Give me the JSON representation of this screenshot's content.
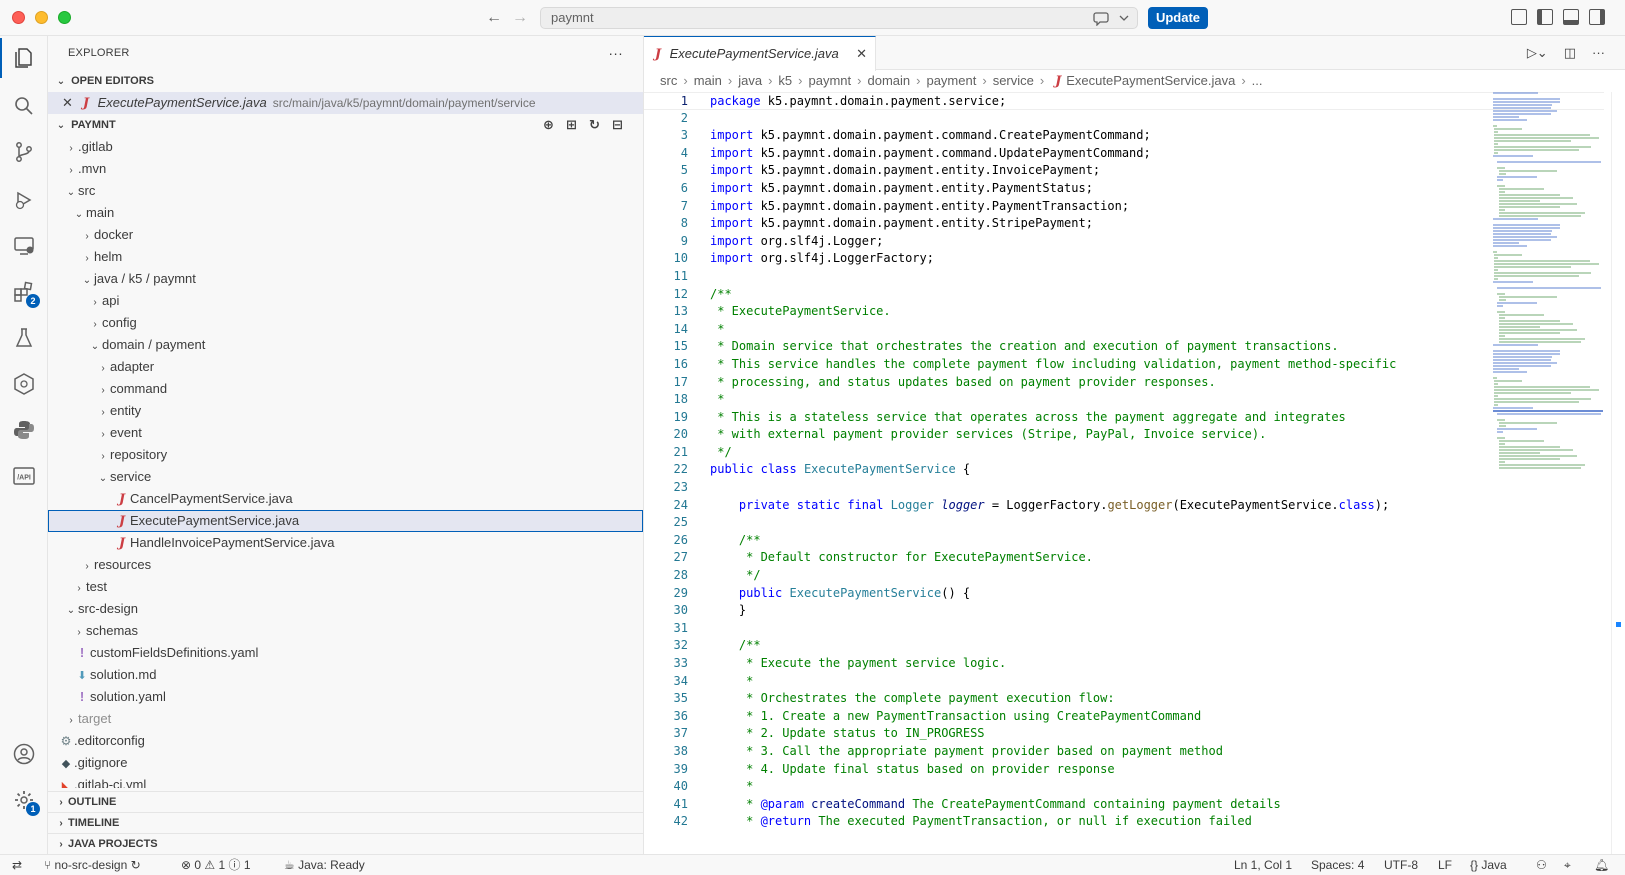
{
  "titlebar": {
    "search_value": "paymnt",
    "update_label": "Update"
  },
  "activity": {
    "extensions_badge": "2",
    "settings_badge": "1"
  },
  "sidebar": {
    "title": "EXPLORER",
    "more": "···",
    "open_editors_label": "OPEN EDITORS",
    "open_editor": {
      "name": "ExecutePaymentService.java",
      "path": "src/main/java/k5/paymnt/domain/payment/service"
    },
    "workspace_label": "PAYMNT",
    "tree": [
      {
        "label": ".gitlab"
      },
      {
        "label": ".mvn"
      },
      {
        "label": "src"
      },
      {
        "label": "main"
      },
      {
        "label": "docker"
      },
      {
        "label": "helm"
      },
      {
        "label": "java / k5 / paymnt"
      },
      {
        "label": "api"
      },
      {
        "label": "config"
      },
      {
        "label": "domain / payment"
      },
      {
        "label": "adapter"
      },
      {
        "label": "command"
      },
      {
        "label": "entity"
      },
      {
        "label": "event"
      },
      {
        "label": "repository"
      },
      {
        "label": "service"
      },
      {
        "label": "CancelPaymentService.java"
      },
      {
        "label": "ExecutePaymentService.java"
      },
      {
        "label": "HandleInvoicePaymentService.java"
      },
      {
        "label": "resources"
      },
      {
        "label": "test"
      },
      {
        "label": "src-design"
      },
      {
        "label": "schemas"
      },
      {
        "label": "customFieldsDefinitions.yaml"
      },
      {
        "label": "solution.md"
      },
      {
        "label": "solution.yaml"
      },
      {
        "label": "target"
      },
      {
        "label": ".editorconfig"
      },
      {
        "label": ".gitignore"
      },
      {
        "label": ".gitlab-ci.yml"
      }
    ],
    "outline_label": "OUTLINE",
    "timeline_label": "TIMELINE",
    "java_projects_label": "JAVA PROJECTS"
  },
  "editor": {
    "tab_label": "ExecutePaymentService.java",
    "breadcrumb": [
      "src",
      "main",
      "java",
      "k5",
      "paymnt",
      "domain",
      "payment",
      "service",
      "ExecutePaymentService.java",
      "..."
    ],
    "lines": [
      "package k5.paymnt.domain.payment.service;",
      "",
      "import k5.paymnt.domain.payment.command.CreatePaymentCommand;",
      "import k5.paymnt.domain.payment.command.UpdatePaymentCommand;",
      "import k5.paymnt.domain.payment.entity.InvoicePayment;",
      "import k5.paymnt.domain.payment.entity.PaymentStatus;",
      "import k5.paymnt.domain.payment.entity.PaymentTransaction;",
      "import k5.paymnt.domain.payment.entity.StripePayment;",
      "import org.slf4j.Logger;",
      "import org.slf4j.LoggerFactory;",
      "",
      "/**",
      " * ExecutePaymentService.",
      " *",
      " * Domain service that orchestrates the creation and execution of payment transactions.",
      " * This service handles the complete payment flow including validation, payment method-specific",
      " * processing, and status updates based on payment provider responses.",
      " *",
      " * This is a stateless service that operates across the payment aggregate and integrates",
      " * with external payment provider services (Stripe, PayPal, Invoice service).",
      " */",
      "public class ExecutePaymentService {",
      "",
      "    private static final Logger logger = LoggerFactory.getLogger(ExecutePaymentService.class);",
      "",
      "    /**",
      "     * Default constructor for ExecutePaymentService.",
      "     */",
      "    public ExecutePaymentService() {",
      "    }",
      "",
      "    /**",
      "     * Execute the payment service logic.",
      "     *",
      "     * Orchestrates the complete payment execution flow:",
      "     * 1. Create a new PaymentTransaction using CreatePaymentCommand",
      "     * 2. Update status to IN_PROGRESS",
      "     * 3. Call the appropriate payment provider based on payment method",
      "     * 4. Update final status based on provider response",
      "     *",
      "     * @param createCommand The CreatePaymentCommand containing payment details",
      "     * @return The executed PaymentTransaction, or null if execution failed"
    ]
  },
  "statusbar": {
    "branch": "no-src-design",
    "errors": "0",
    "warnings": "1",
    "info": "1",
    "java_status": "Java: Ready",
    "position": "Ln 1, Col 1",
    "spaces": "Spaces: 4",
    "encoding": "UTF-8",
    "eol": "LF",
    "language": "Java"
  },
  "colors": {
    "accent": "#005fb8",
    "java_icon": "#cc3e44",
    "keyword": "#0000ff",
    "comment": "#008000",
    "type": "#267f99"
  }
}
